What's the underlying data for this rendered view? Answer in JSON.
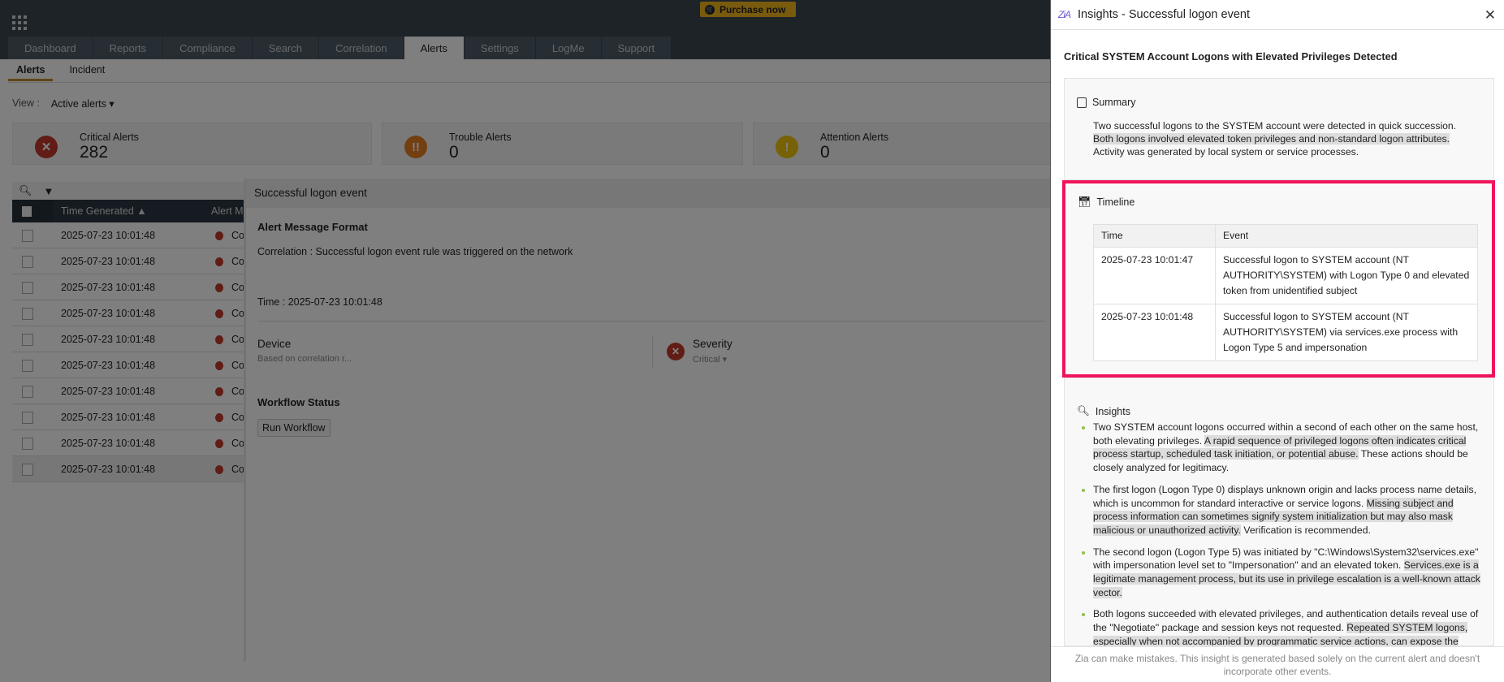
{
  "topbar": {
    "purchase_label": "Purchase now"
  },
  "nav_tabs": [
    "Dashboard",
    "Reports",
    "Compliance",
    "Search",
    "Correlation",
    "Alerts",
    "Settings",
    "LogMe",
    "Support"
  ],
  "active_tab": "Alerts",
  "sub_tabs": [
    "Alerts",
    "Incident"
  ],
  "view": {
    "label": "View :",
    "value": "Active alerts"
  },
  "cards": [
    {
      "title": "Critical Alerts",
      "count": "282",
      "color": "#c0392b",
      "icon": "x"
    },
    {
      "title": "Trouble Alerts",
      "count": "0",
      "color": "#e67e22",
      "icon": "!!"
    },
    {
      "title": "Attention Alerts",
      "count": "0",
      "color": "#f1c40f",
      "icon": "!"
    }
  ],
  "table": {
    "columns": [
      "Time Generated",
      "Alert M"
    ],
    "rows": [
      {
        "time": "2025-07-23 10:01:48",
        "msg": "Co"
      },
      {
        "time": "2025-07-23 10:01:48",
        "msg": "Co"
      },
      {
        "time": "2025-07-23 10:01:48",
        "msg": "Co"
      },
      {
        "time": "2025-07-23 10:01:48",
        "msg": "Co"
      },
      {
        "time": "2025-07-23 10:01:48",
        "msg": "Co"
      },
      {
        "time": "2025-07-23 10:01:48",
        "msg": "Co"
      },
      {
        "time": "2025-07-23 10:01:48",
        "msg": "Co"
      },
      {
        "time": "2025-07-23 10:01:48",
        "msg": "Co"
      },
      {
        "time": "2025-07-23 10:01:48",
        "msg": "Co"
      },
      {
        "time": "2025-07-23 10:01:48",
        "msg": "Co"
      }
    ]
  },
  "detail": {
    "title": "Successful logon event",
    "format_heading": "Alert Message Format",
    "correlation": "Correlation : Successful logon event rule was triggered on the network",
    "time": "Time : 2025-07-23 10:01:48",
    "device_label": "Device",
    "device_value": "Based on correlation r...",
    "severity_label": "Severity",
    "severity_value": "Critical",
    "workflow_heading": "Workflow Status",
    "run_workflow": "Run Workflow"
  },
  "panel": {
    "logo": "Zia",
    "title": "Insights - Successful logon event",
    "heading": "Critical SYSTEM Account Logons with Elevated Privileges Detected",
    "summary_label": "Summary",
    "summary": [
      "Two successful logons to the SYSTEM account were detected in quick succession.",
      "Both logons involved elevated token privileges and non-standard logon attributes.",
      "Activity was generated by local system or service processes."
    ],
    "timeline_label": "Timeline",
    "timeline_cols": [
      "Time",
      "Event"
    ],
    "timeline": [
      {
        "time": "2025-07-23 10:01:47",
        "event": "Successful logon to SYSTEM account (NT AUTHORITY\\SYSTEM) with Logon Type 0 and elevated token from unidentified subject"
      },
      {
        "time": "2025-07-23 10:01:48",
        "event": "Successful logon to SYSTEM account (NT AUTHORITY\\SYSTEM) via services.exe process with Logon Type 5 and impersonation"
      }
    ],
    "insights_label": "Insights",
    "insights": [
      [
        "Two SYSTEM account logons occurred within a second of each other on the same host, both elevating privileges. ",
        "A rapid sequence of privileged logons often indicates critical process startup, scheduled task initiation, or potential abuse.",
        " These actions should be closely analyzed for legitimacy."
      ],
      [
        "The first logon (Logon Type 0) displays unknown origin and lacks process name details, which is uncommon for standard interactive or service logons. ",
        "Missing subject and process information can sometimes signify system initialization but may also mask malicious or unauthorized activity.",
        " Verification is recommended."
      ],
      [
        "The second logon (Logon Type 5) was initiated by \"C:\\Windows\\System32\\services.exe\" with impersonation level set to \"Impersonation\" and an elevated token. ",
        "Services.exe is a legitimate management process, but its use in privilege escalation is a well-known attack vector.",
        ""
      ],
      [
        "Both logons succeeded with elevated privileges, and authentication details reveal use of the \"Negotiate\" package and session keys not requested. ",
        "Repeated SYSTEM logons, especially when not accompanied by programmatic service actions, can expose the platform to privilege escalation risk, persistence mechanisms, or lateral",
        ""
      ]
    ],
    "footer": "Zia can make mistakes. This insight is generated based solely on the current alert and doesn't incorporate other events."
  }
}
